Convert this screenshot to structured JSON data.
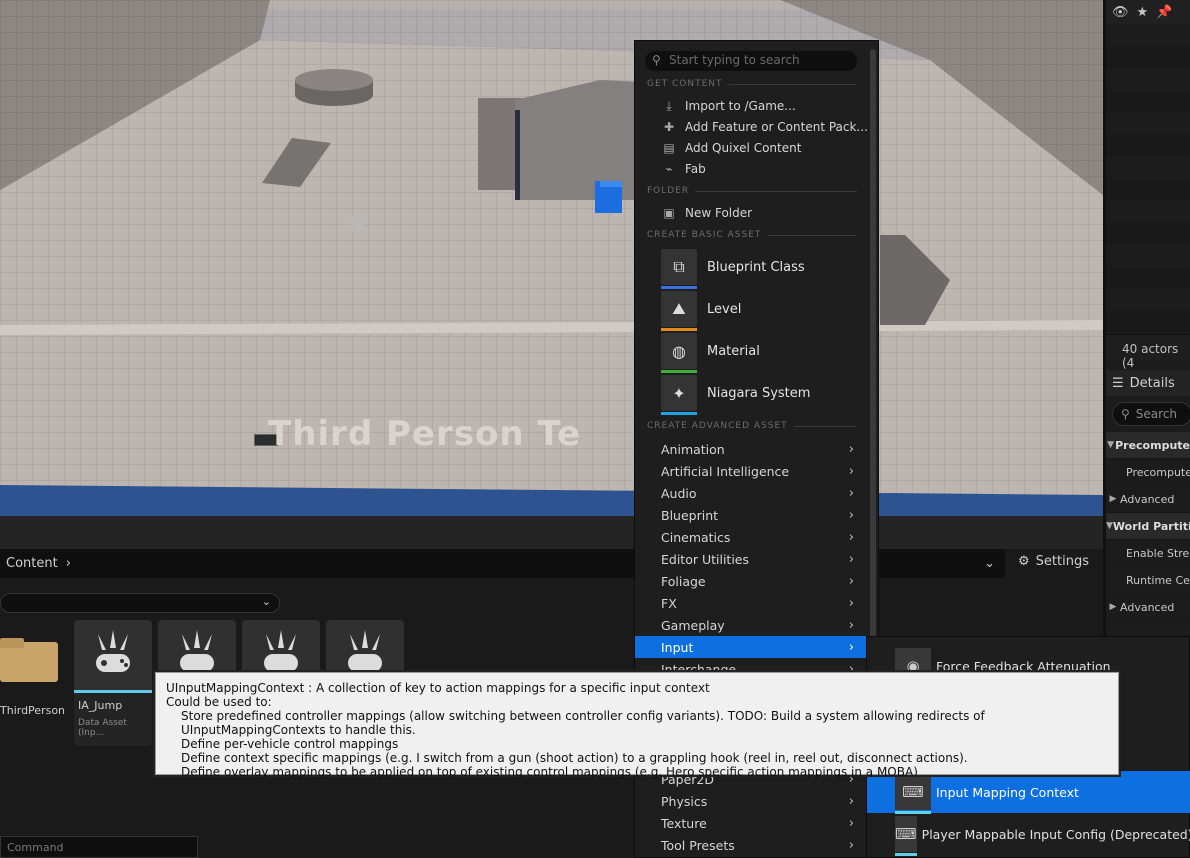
{
  "viewport": {
    "overlay_text": "Third Person Te"
  },
  "outliner": {
    "toolbar_icons": [
      "eye-icon",
      "star-icon",
      "pin-icon"
    ],
    "actors_count": "40 actors (4",
    "details_tab_label": "Details",
    "details_search_placeholder": "Search",
    "rows": [
      {
        "label": "Precompute",
        "type": "header",
        "expanded": true
      },
      {
        "label": "Precompute",
        "type": "child"
      },
      {
        "label": "Advanced",
        "type": "collapsed"
      },
      {
        "label": "World Partiti",
        "type": "header",
        "expanded": true
      },
      {
        "label": "Enable Strea",
        "type": "child"
      },
      {
        "label": "Runtime Cel",
        "type": "child"
      },
      {
        "label": "Advanced",
        "type": "collapsed"
      }
    ]
  },
  "content_browser": {
    "path_root": "Content",
    "settings_label": "Settings",
    "command_placeholder": "Command",
    "tiles": [
      {
        "name": "ThirdPerson",
        "type": "folder"
      },
      {
        "name": "IA_Jump",
        "kind": "Data Asset (Inp...",
        "type": "asset"
      },
      {
        "name": "",
        "type": "asset"
      },
      {
        "name": "",
        "type": "asset"
      },
      {
        "name": "",
        "type": "asset"
      }
    ]
  },
  "menu": {
    "search_placeholder": "Start typing to search",
    "sections": {
      "get_content": "GET CONTENT",
      "folder": "FOLDER",
      "create_basic": "CREATE BASIC ASSET",
      "create_advanced": "CREATE ADVANCED ASSET"
    },
    "get_content_items": [
      {
        "label": "Import to /Game...",
        "icon": "import-icon"
      },
      {
        "label": "Add Feature or Content Pack...",
        "icon": "feature-pack-icon"
      },
      {
        "label": "Add Quixel Content",
        "icon": "quixel-icon"
      },
      {
        "label": "Fab",
        "icon": "fab-icon"
      }
    ],
    "folder_items": [
      {
        "label": "New Folder",
        "icon": "new-folder-icon"
      }
    ],
    "basic_assets": [
      {
        "label": "Blueprint Class",
        "color": "#3a6fe0"
      },
      {
        "label": "Level",
        "color": "#e08a1a"
      },
      {
        "label": "Material",
        "color": "#3fae3f"
      },
      {
        "label": "Niagara System",
        "color": "#1fa2e0"
      }
    ],
    "categories": [
      "Animation",
      "Artificial Intelligence",
      "Audio",
      "Blueprint",
      "Cinematics",
      "Editor Utilities",
      "Foliage",
      "FX",
      "Gameplay",
      "Input",
      "Interchange",
      "",
      "",
      "",
      "",
      "Paper2D",
      "Physics",
      "Texture",
      "Tool Presets"
    ],
    "active_category": "Input"
  },
  "submenu": {
    "items": [
      {
        "label": "Force Feedback Attenuation",
        "active": false
      },
      {
        "label": "Input Mapping Context",
        "active": true
      },
      {
        "label": "Player Mappable Input Config (Deprecated)",
        "active": false
      }
    ]
  },
  "tooltip": {
    "title": "UInputMappingContext : A collection of key to action mappings for a specific input context",
    "intro": "Could be used to:",
    "lines": [
      "Store predefined controller mappings (allow switching between controller config variants). TODO: Build a system allowing redirects of UInputMappingContexts to handle this.",
      "Define per-vehicle control mappings",
      "Define context specific mappings (e.g. I switch from a gun (shoot action) to a grappling hook (reel in, reel out, disconnect actions).",
      "Define overlay mappings to be applied on top of existing control mappings (e.g. Hero specific action mappings in a MOBA)"
    ]
  }
}
